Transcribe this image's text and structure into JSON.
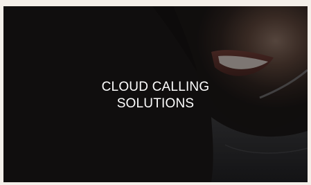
{
  "banner": {
    "headline_line1": "CLOUD CALLING",
    "headline_line2": "SOLUTIONS",
    "image_icon": "smiling-agent-headset-photo",
    "colors": {
      "page_background": "#f4efe9",
      "overlay_dark": "#080706",
      "text": "#ffffff"
    }
  }
}
